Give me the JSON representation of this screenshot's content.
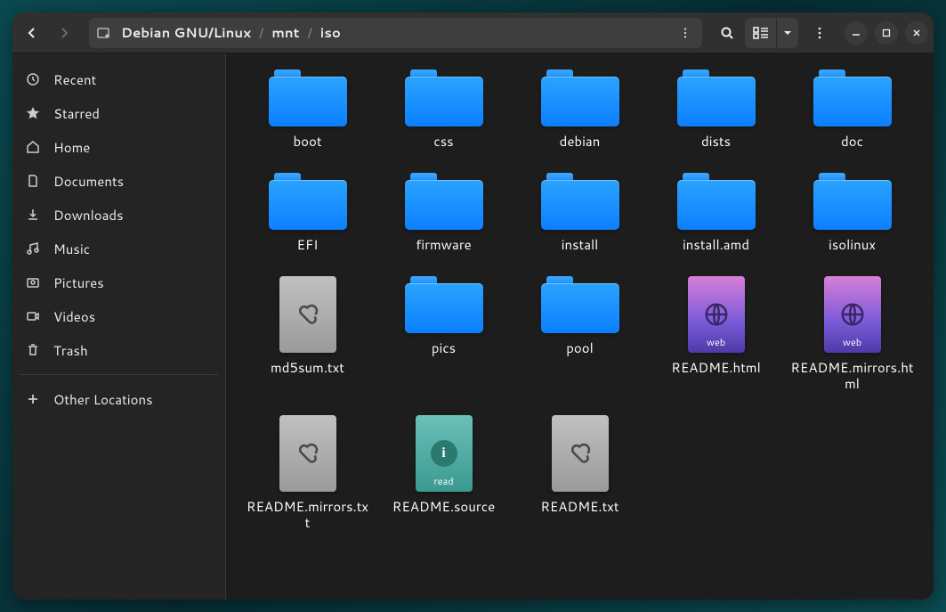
{
  "breadcrumb": {
    "seg0": "Debian GNU/Linux",
    "seg1": "mnt",
    "seg2": "iso"
  },
  "sidebar": {
    "recent": "Recent",
    "starred": "Starred",
    "home": "Home",
    "documents": "Documents",
    "downloads": "Downloads",
    "music": "Music",
    "pictures": "Pictures",
    "videos": "Videos",
    "trash": "Trash",
    "other": "Other Locations"
  },
  "items": {
    "boot": "boot",
    "css": "css",
    "debian": "debian",
    "dists": "dists",
    "doc": "doc",
    "efi": "EFI",
    "firmware": "firmware",
    "install": "install",
    "installamd": "install.amd",
    "isolinux": "isolinux",
    "md5sum": "md5sum.txt",
    "pics": "pics",
    "pool": "pool",
    "readmehtml": "README.html",
    "readmemirrorshtml": "README.mirrors.html",
    "readmemirrorstxt": "README.mirrors.txt",
    "readmesource": "README.source",
    "readmetxt": "README.txt"
  },
  "tags": {
    "web": "web",
    "read": "read"
  }
}
